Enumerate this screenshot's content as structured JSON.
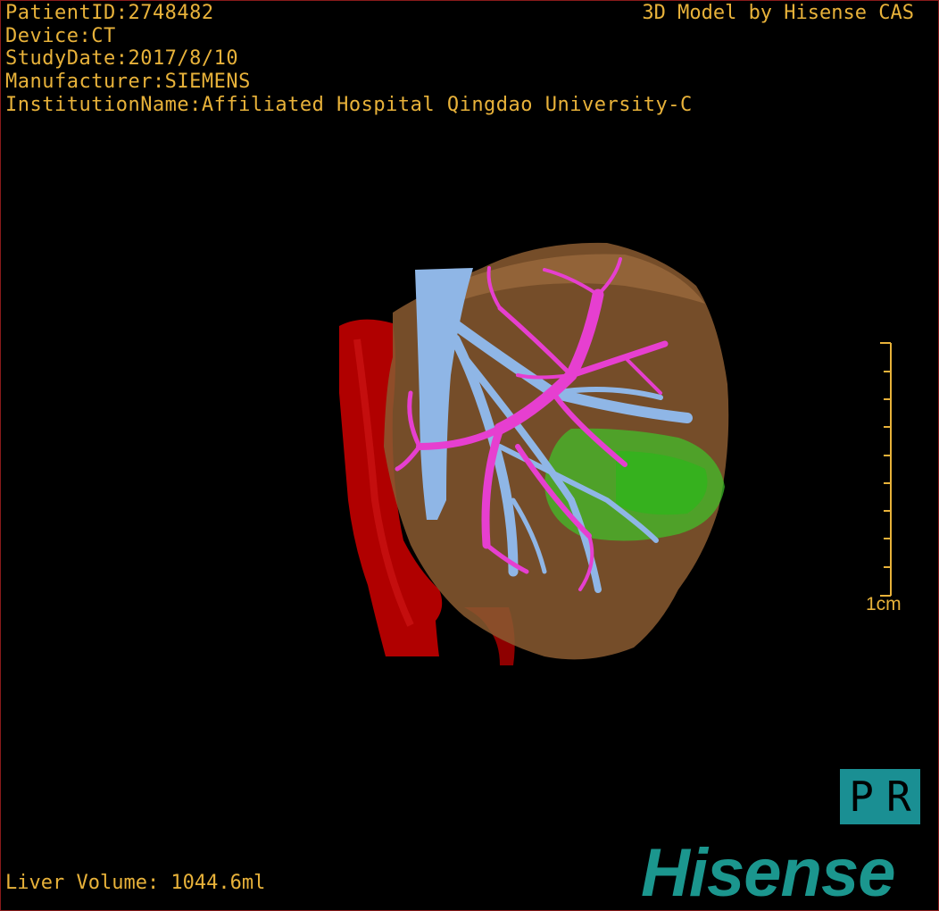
{
  "overlay": {
    "patient_id": "PatientID:2748482",
    "device": "Device:CT",
    "study_date": "StudyDate:2017/8/10",
    "manufacturer": "Manufacturer:SIEMENS",
    "institution": "InstitutionName:Affiliated Hospital Qingdao University-C",
    "credit": "3D Model by Hisense CAS",
    "liver_volume": "Liver Volume: 1044.6ml"
  },
  "scale_bar": {
    "label": "1cm"
  },
  "orientation": {
    "left": "P",
    "right": "R"
  },
  "brand": {
    "logo_text": "Hisense"
  },
  "colors": {
    "overlay_text": "#e8b23a",
    "liver": "#a06a3a",
    "portal_vein": "#e63fd0",
    "hepatic_vein": "#8fb6e6",
    "aorta": "#b00000",
    "lesion": "#3fc42a",
    "brand": "#1b968e"
  }
}
